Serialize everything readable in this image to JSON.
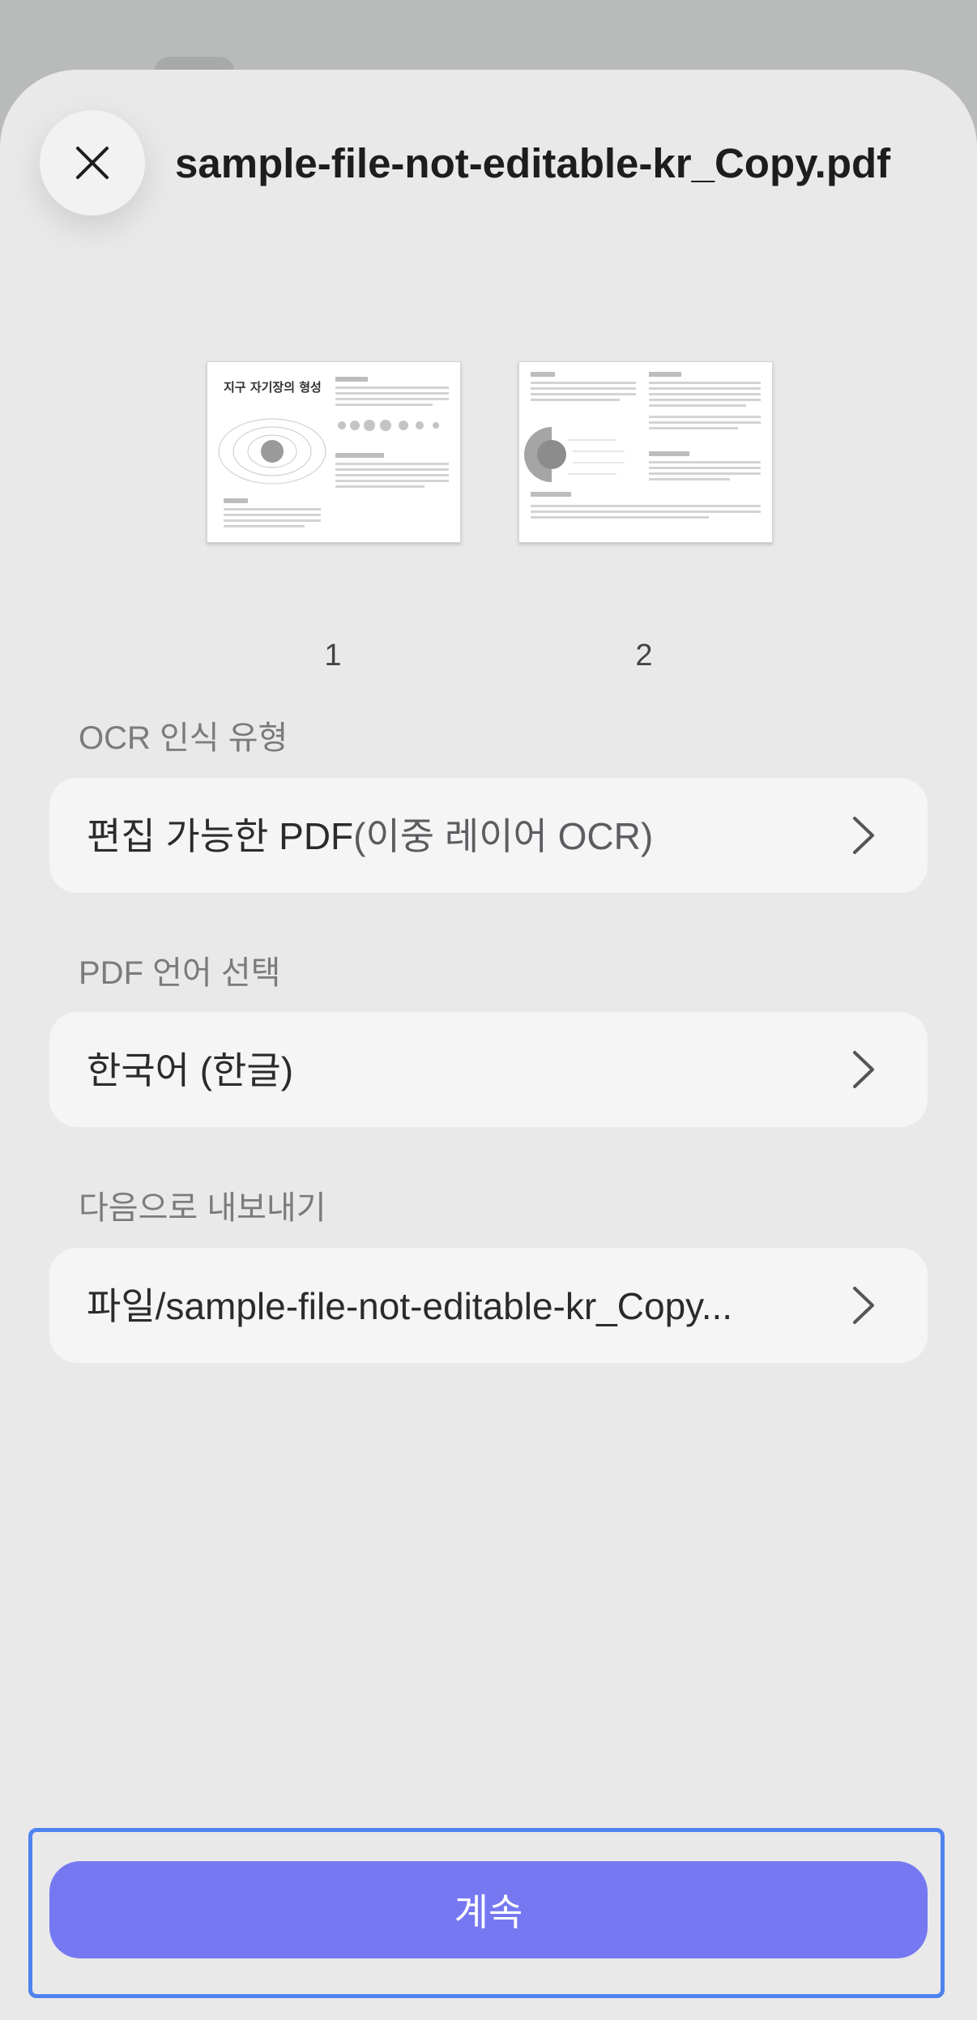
{
  "header": {
    "file_name": "sample-file-not-editable-kr_Copy.pdf"
  },
  "pages": [
    {
      "number": "1"
    },
    {
      "number": "2"
    }
  ],
  "thumbnail_page_1": {
    "heading": "지구 자기장의 형성"
  },
  "ocr_type": {
    "label": "OCR 인식 유형",
    "value_main": "편집 가능한 PDF",
    "value_detail": "(이중 레이어 OCR)"
  },
  "pdf_language": {
    "label": "PDF 언어 선택",
    "value": "한국어 (한글)"
  },
  "export_to": {
    "label": "다음으로 내보내기",
    "value": "파일/sample-file-not-editable-kr_Copy..."
  },
  "continue_button": {
    "label": "계속"
  },
  "icons": [
    "close-icon",
    "chevron-right-icon"
  ],
  "colors": {
    "primary_button": "#7678f1",
    "focus_ring": "#4f83ef",
    "sheet_background": "#e9e9ea"
  }
}
